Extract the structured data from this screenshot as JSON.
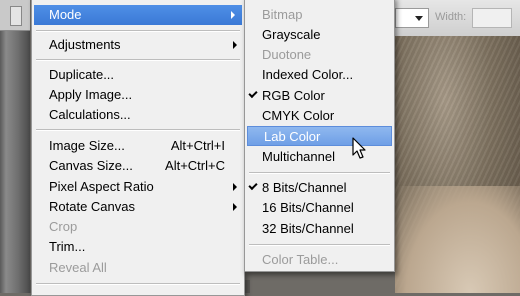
{
  "toolbar": {
    "width_label": "Width:"
  },
  "image_menu": {
    "items": [
      {
        "label": "Mode",
        "state": "highlighted",
        "submenu": true
      },
      {
        "label": "Adjustments",
        "submenu": true
      },
      {
        "label": "Duplicate..."
      },
      {
        "label": "Apply Image..."
      },
      {
        "label": "Calculations..."
      },
      {
        "label": "Image Size...",
        "shortcut": "Alt+Ctrl+I"
      },
      {
        "label": "Canvas Size...",
        "shortcut": "Alt+Ctrl+C"
      },
      {
        "label": "Pixel Aspect Ratio",
        "submenu": true
      },
      {
        "label": "Rotate Canvas",
        "submenu": true
      },
      {
        "label": "Crop",
        "disabled": true
      },
      {
        "label": "Trim..."
      },
      {
        "label": "Reveal All",
        "disabled": true
      }
    ]
  },
  "mode_submenu": {
    "items": [
      {
        "label": "Bitmap",
        "disabled": true
      },
      {
        "label": "Grayscale"
      },
      {
        "label": "Duotone",
        "disabled": true
      },
      {
        "label": "Indexed Color..."
      },
      {
        "label": "RGB Color",
        "checked": true
      },
      {
        "label": "CMYK Color"
      },
      {
        "label": "Lab Color",
        "state": "hovered"
      },
      {
        "label": "Multichannel"
      },
      {
        "label": "8 Bits/Channel",
        "checked": true
      },
      {
        "label": "16 Bits/Channel"
      },
      {
        "label": "32 Bits/Channel"
      },
      {
        "label": "Color Table...",
        "disabled": true
      }
    ]
  },
  "colors": {
    "menu_background": "#f0f0f0",
    "highlight": "#3b79d6",
    "hover": "#7fa9ea",
    "disabled_text": "#9b9b9b"
  }
}
